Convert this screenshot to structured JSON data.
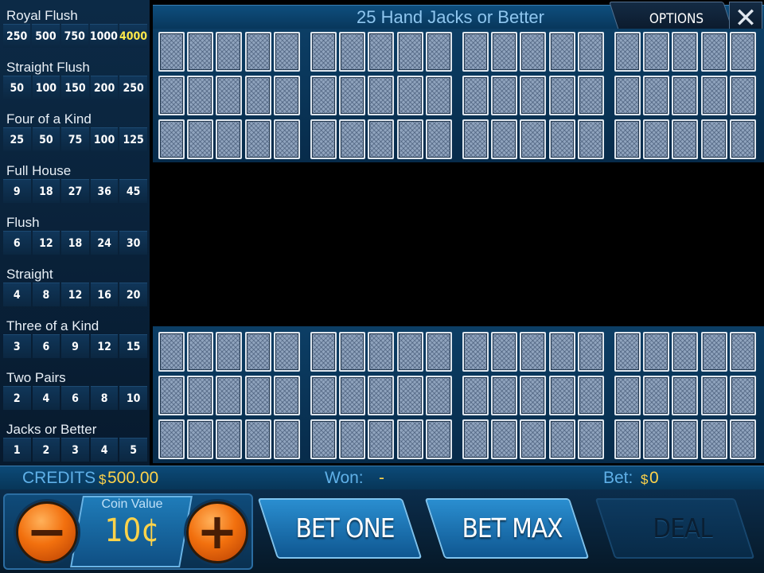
{
  "paytable": {
    "rows": [
      {
        "name": "Royal Flush",
        "pays": [
          "250",
          "500",
          "750",
          "1000",
          "4000"
        ]
      },
      {
        "name": "Straight Flush",
        "pays": [
          "50",
          "100",
          "150",
          "200",
          "250"
        ]
      },
      {
        "name": "Four of a Kind",
        "pays": [
          "25",
          "50",
          "75",
          "100",
          "125"
        ]
      },
      {
        "name": "Full House",
        "pays": [
          "9",
          "18",
          "27",
          "36",
          "45"
        ]
      },
      {
        "name": "Flush",
        "pays": [
          "6",
          "12",
          "18",
          "24",
          "30"
        ]
      },
      {
        "name": "Straight",
        "pays": [
          "4",
          "8",
          "12",
          "16",
          "20"
        ]
      },
      {
        "name": "Three of a Kind",
        "pays": [
          "3",
          "6",
          "9",
          "12",
          "15"
        ]
      },
      {
        "name": "Two Pairs",
        "pays": [
          "2",
          "4",
          "6",
          "8",
          "10"
        ]
      },
      {
        "name": "Jacks or Better",
        "pays": [
          "1",
          "2",
          "3",
          "4",
          "5"
        ]
      }
    ],
    "highlight_color": "#ffe94a"
  },
  "header": {
    "title": "25 Hand Jacks or Better",
    "options_label": "OPTIONS",
    "close_glyph": "✕"
  },
  "hands": {
    "count": 25,
    "cards_per_hand": 5
  },
  "status": {
    "credits_label": "CREDITS",
    "credits_currency": "$",
    "credits_value": "500.00",
    "won_label": "Won:",
    "won_value": "-",
    "bet_label": "Bet:",
    "bet_currency": "$",
    "bet_value": "0"
  },
  "controls": {
    "minus_glyph": "−",
    "plus_glyph": "+",
    "coin_value_label": "Coin Value",
    "coin_value": "10¢",
    "bet_one_label": "BET ONE",
    "bet_max_label": "BET MAX",
    "deal_label": "DEAL"
  },
  "colors": {
    "accent_blue": "#2a8ed0",
    "gold": "#ffd34a",
    "orange": "#f2700e"
  }
}
